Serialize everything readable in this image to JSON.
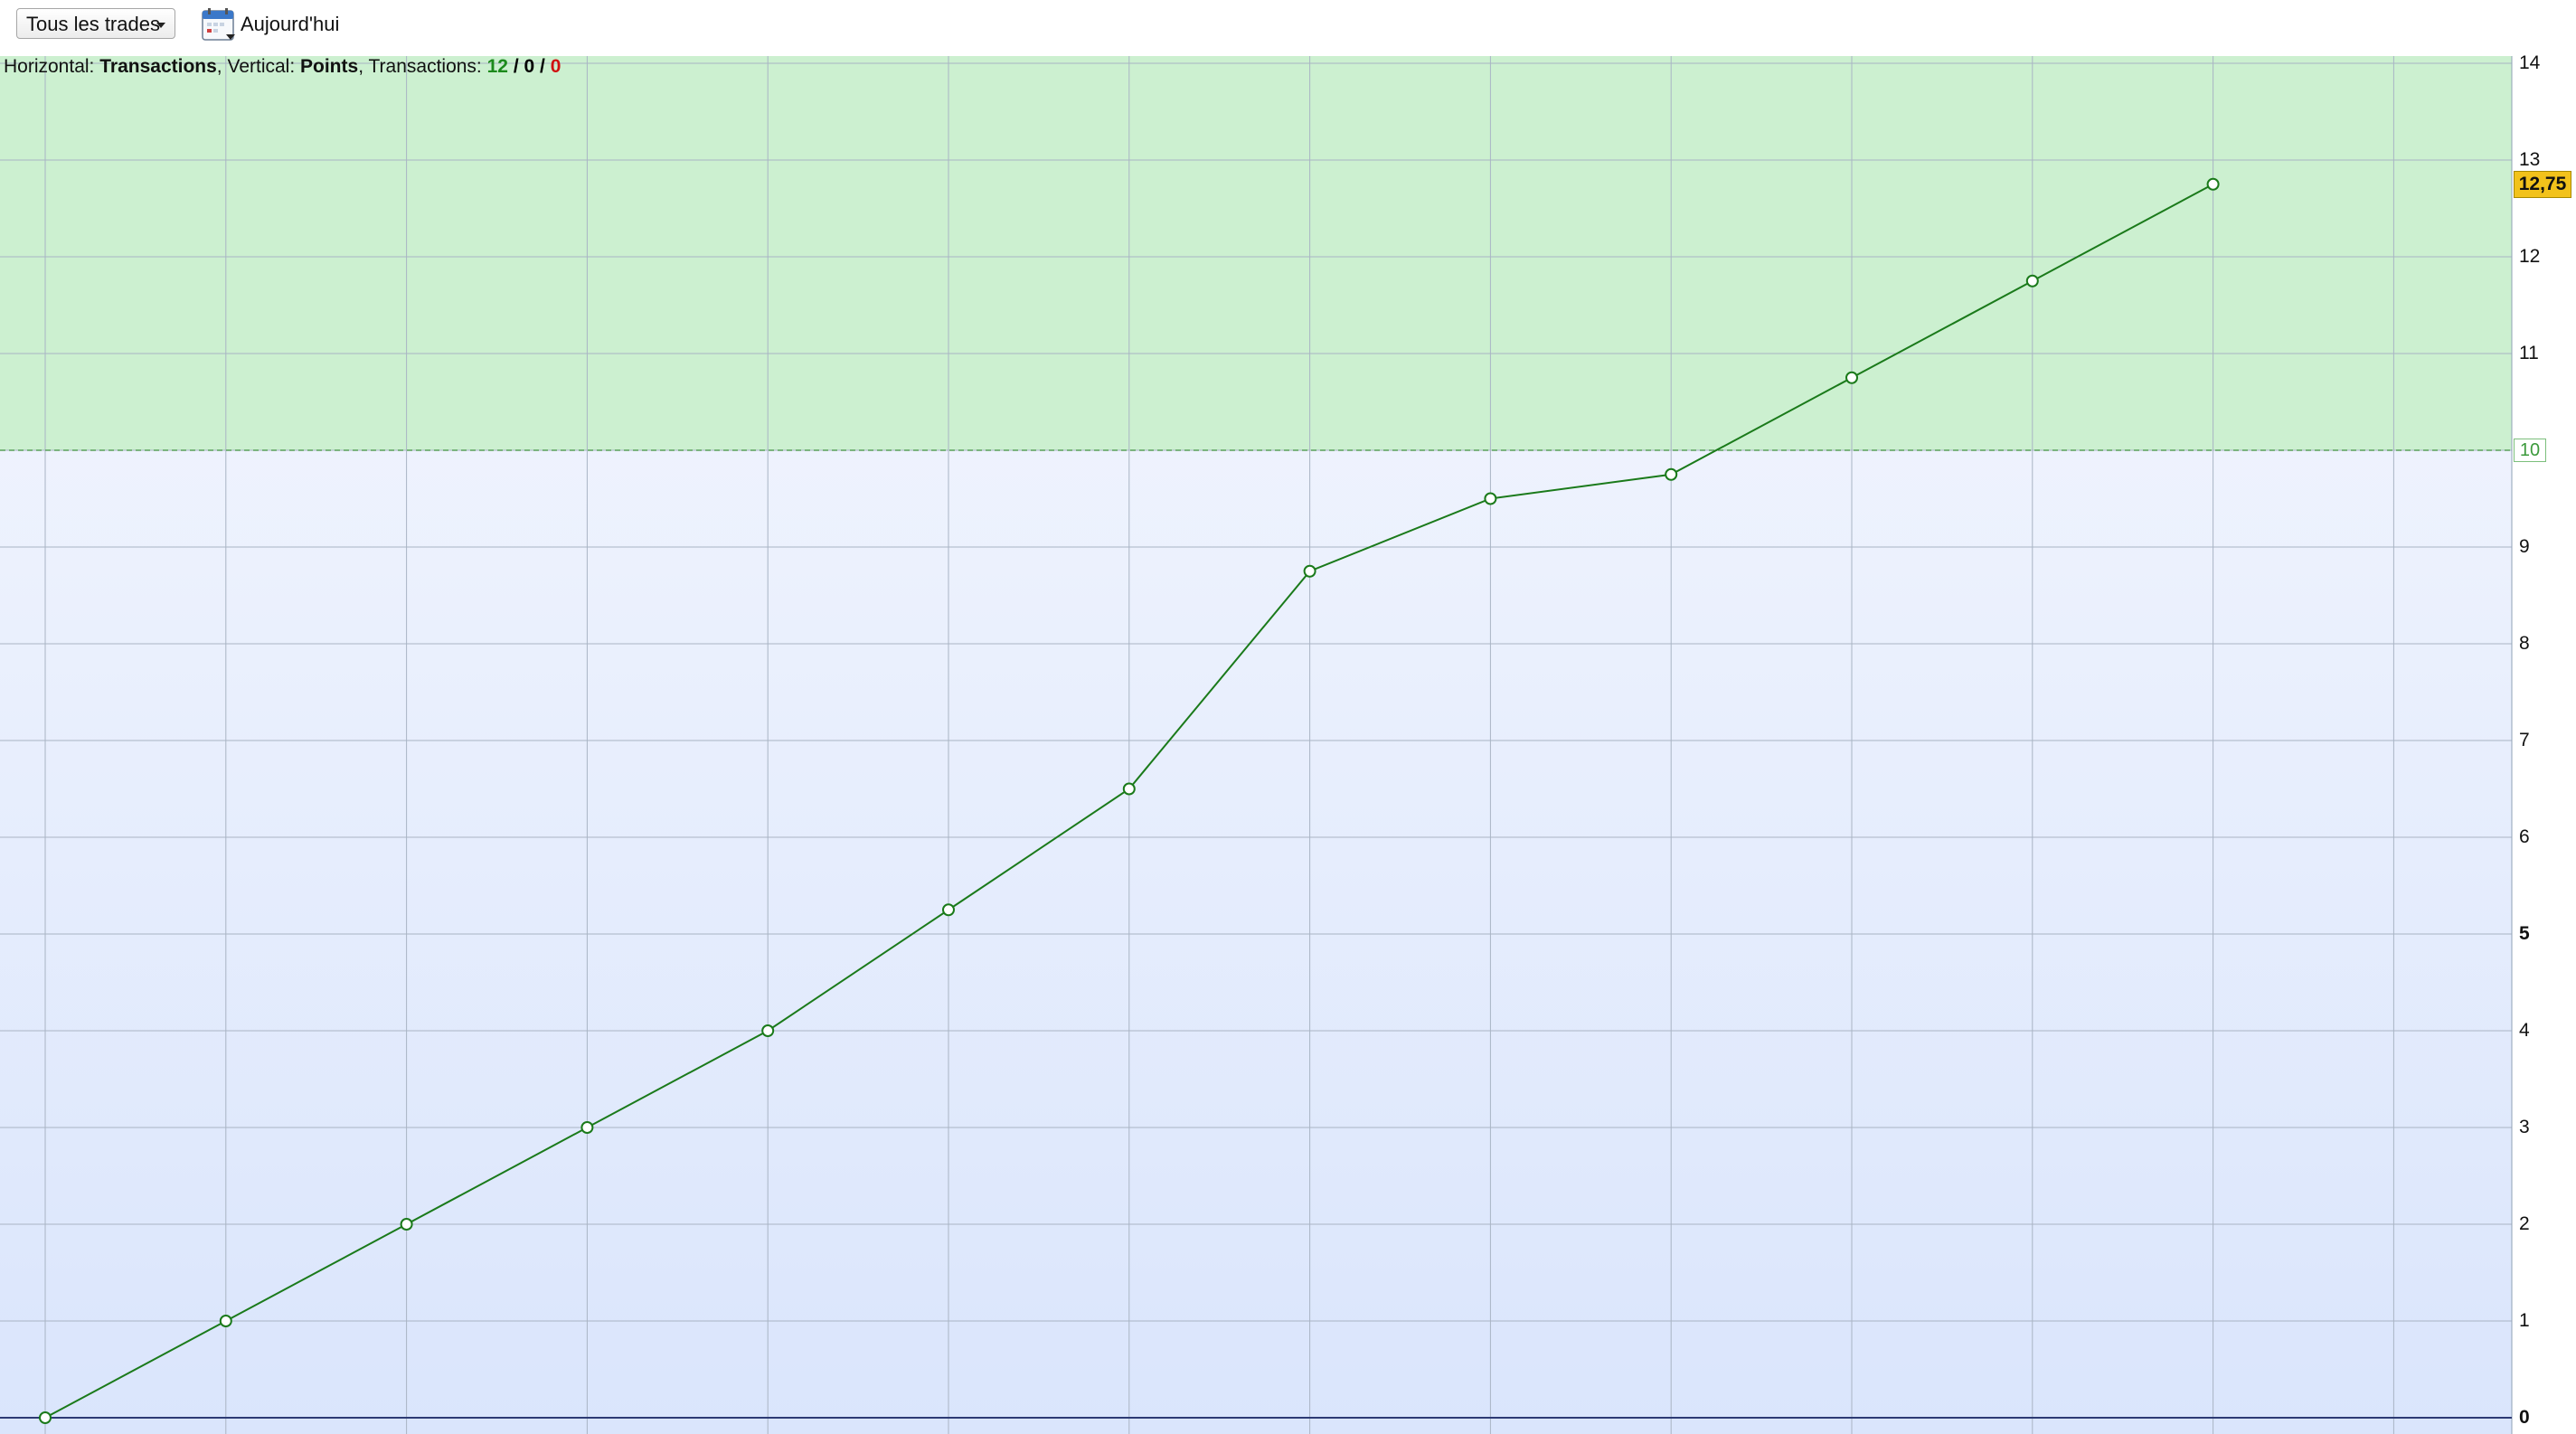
{
  "toolbar": {
    "filter": {
      "selected": "Tous les trades"
    },
    "date_label": "Aujourd'hui",
    "calendar_icon": "calendar-icon"
  },
  "info": {
    "h_label": "Horizontal:",
    "h_value": "Transactions",
    "v_label": "Vertical:",
    "v_value": "Points",
    "t_label": "Transactions:",
    "t_win": "12",
    "t_even": "0",
    "t_loss": "0"
  },
  "colors": {
    "profit_zone": "#ccf0d0",
    "line": "#1a7a1a",
    "grid": "#a9b4c4",
    "badge": "#f2c21b",
    "win": "#1c8a1c",
    "loss": "#d01010"
  },
  "chart_data": {
    "type": "line",
    "x": [
      0,
      1,
      2,
      3,
      4,
      5,
      6,
      7,
      8,
      9,
      10,
      11,
      12
    ],
    "series": [
      {
        "values": [
          0,
          1,
          2,
          3,
          4,
          5.25,
          6.5,
          8.75,
          9.5,
          9.75,
          10.75,
          11.75,
          12.75
        ]
      }
    ],
    "xlim": [
      0,
      13
    ],
    "ylim": [
      0,
      14
    ],
    "y_ticks": [
      {
        "value": 0,
        "label": "0",
        "bold": true
      },
      {
        "value": 1,
        "label": "1"
      },
      {
        "value": 2,
        "label": "2"
      },
      {
        "value": 3,
        "label": "3"
      },
      {
        "value": 4,
        "label": "4"
      },
      {
        "value": 5,
        "label": "5",
        "bold": true
      },
      {
        "value": 6,
        "label": "6"
      },
      {
        "value": 7,
        "label": "7"
      },
      {
        "value": 8,
        "label": "8"
      },
      {
        "value": 9,
        "label": "9"
      },
      {
        "value": 11,
        "label": "11"
      },
      {
        "value": 12,
        "label": "12"
      },
      {
        "value": 13,
        "label": "13"
      },
      {
        "value": 14,
        "label": "14"
      }
    ],
    "threshold": {
      "value": 10,
      "label": "10"
    },
    "last_value": {
      "value": 12.75,
      "label": "12,75"
    },
    "grid": true
  }
}
